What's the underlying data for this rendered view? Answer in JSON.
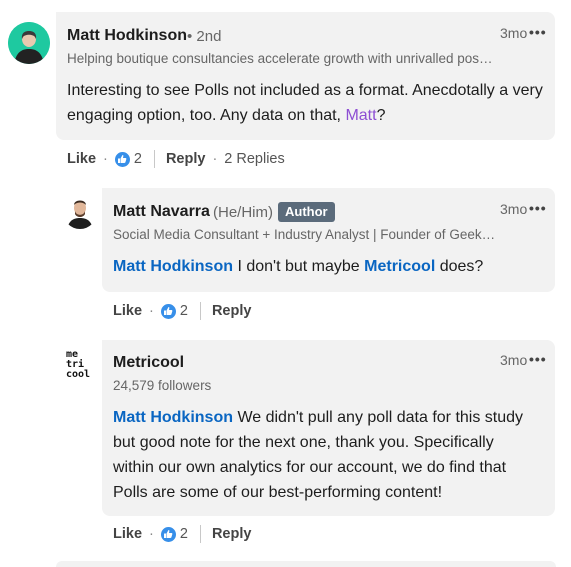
{
  "comments": [
    {
      "author": "Matt Hodkinson",
      "degree": "• 2nd",
      "headline": "Helping boutique consultancies accelerate growth with unrivalled pos…",
      "time": "3mo",
      "more": "•••",
      "text_before": "Interesting to see Polls not included as a format. Anecdotally a very engaging option, too. Any data on that, ",
      "mention": "Matt",
      "text_after": "?",
      "like_label": "Like",
      "like_count": "2",
      "reply_label": "Reply",
      "replies_label": "2 Replies",
      "avatar_color": "#1ec9a0"
    },
    {
      "author": "Matt Navarra",
      "pronoun": "(He/Him)",
      "badge": "Author",
      "headline": "Social Media Consultant + Industry Analyst | Founder of Geek…",
      "time": "3mo",
      "more": "•••",
      "mention": "Matt Hodkinson",
      "text_after": " I don't but maybe ",
      "mention2": "Metricool",
      "text_after2": " does?",
      "like_label": "Like",
      "like_count": "2",
      "reply_label": "Reply"
    },
    {
      "author": "Metricool",
      "followers": "24,579 followers",
      "logo_line1": "me",
      "logo_line2": "tri",
      "logo_line3": "cool",
      "time": "3mo",
      "more": "•••",
      "mention": "Matt Hodkinson",
      "text_after": " We didn't pull any poll data for this study but good note for the next one, thank you. Specifically within our own analytics for our account, we do find that Polls are some of our best-performing content!",
      "like_label": "Like",
      "like_count": "2",
      "reply_label": "Reply"
    }
  ],
  "colors": {
    "bubble": "#f2f2f2",
    "link_blue": "#0a66c2",
    "mention_purple": "#8d4ed3",
    "like_blue": "#378fe9",
    "badge": "#5b6b7b"
  }
}
